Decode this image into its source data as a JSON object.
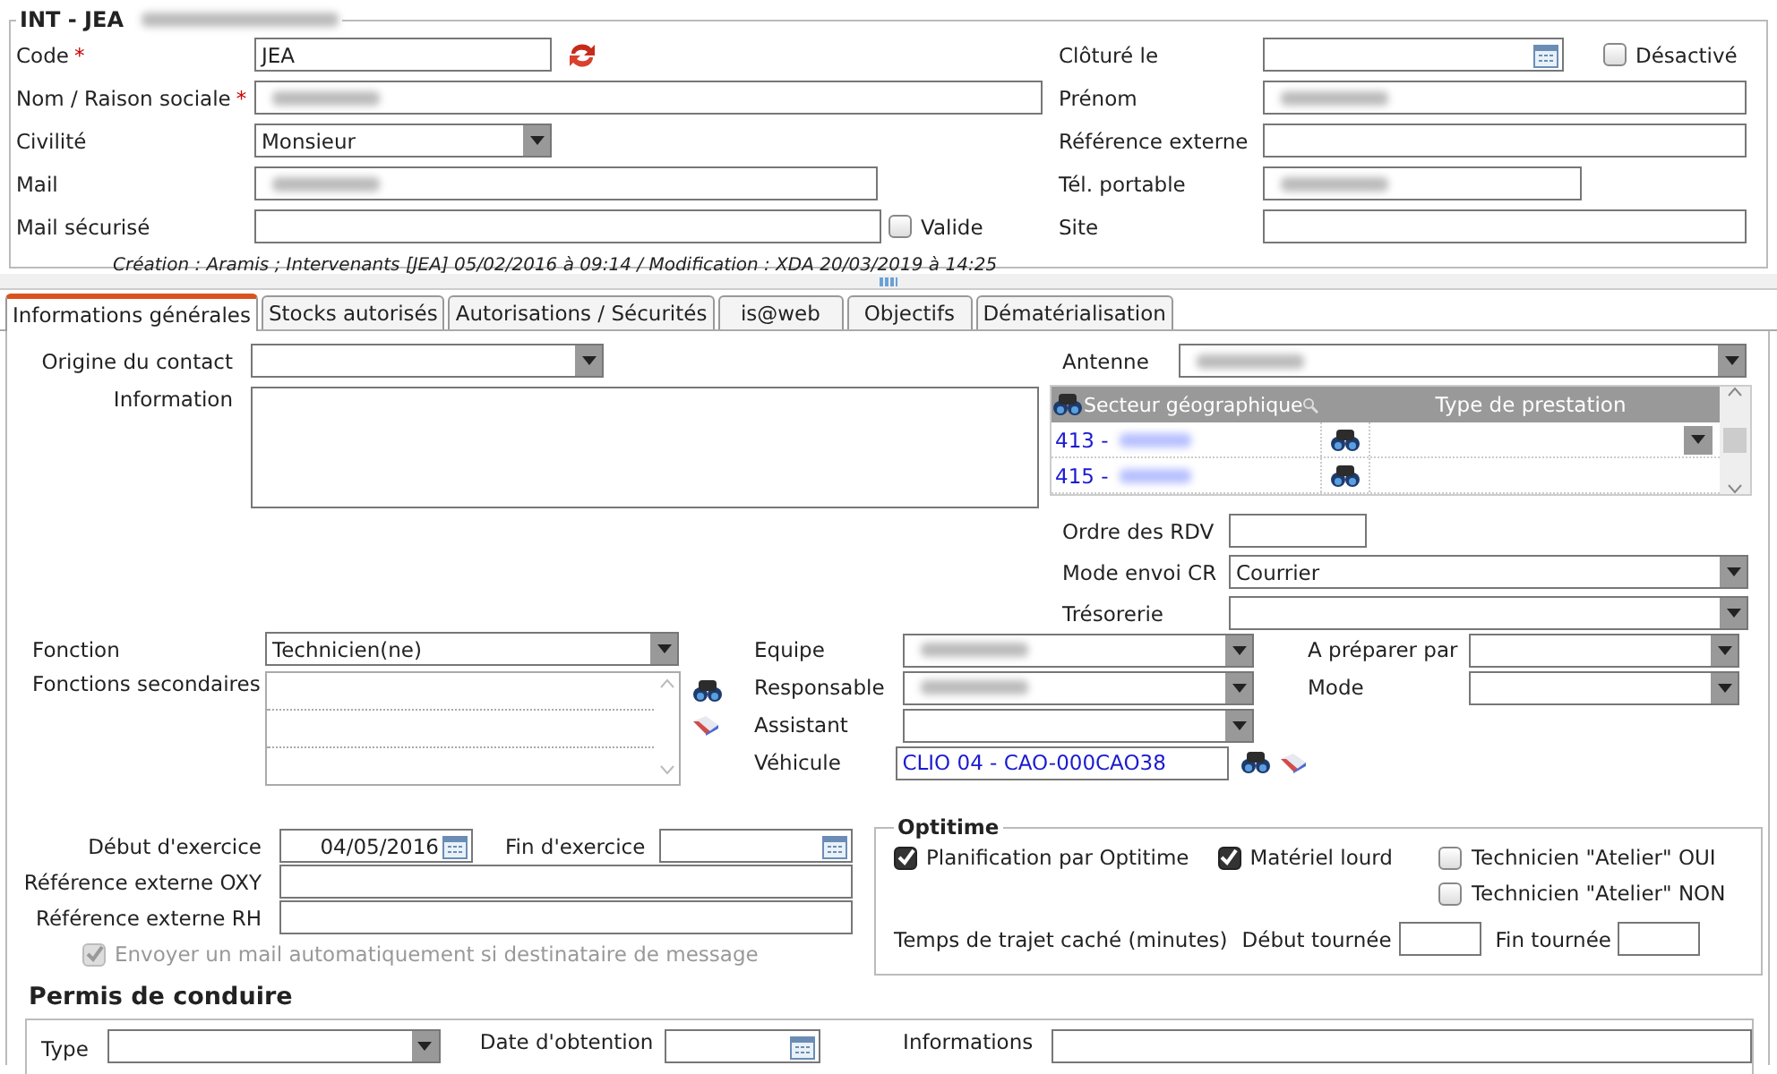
{
  "header": {
    "title": "INT - JEA",
    "title_blurred": true,
    "left": [
      {
        "kind": "text",
        "label": "Code",
        "required_mark": "*",
        "value": "JEA",
        "refresh": true
      },
      {
        "kind": "text",
        "label": "Nom / Raison sociale",
        "required_mark": "*",
        "blurred": true
      },
      {
        "kind": "select",
        "label": "Civilité",
        "value": "Monsieur"
      },
      {
        "kind": "text",
        "label": "Mail",
        "blurred": true
      },
      {
        "kind": "text",
        "label": "Mail sécurisé",
        "checkbox": {
          "label": "Valide",
          "checked": false
        }
      }
    ],
    "right": [
      {
        "kind": "date",
        "label": "Clôturé le",
        "checkbox": {
          "label": "Désactivé",
          "checked": false
        }
      },
      {
        "kind": "text",
        "label": "Prénom",
        "blurred": true
      },
      {
        "kind": "text",
        "label": "Référence externe"
      },
      {
        "kind": "text",
        "label": "Tél. portable",
        "blurred": true
      },
      {
        "kind": "text",
        "label": "Site"
      }
    ],
    "audit": "Création : Aramis ; Intervenants [JEA] 05/02/2016 à 09:14 / Modification : XDA 20/03/2019 à 14:25"
  },
  "tabs": [
    {
      "label": "Informations générales",
      "selected": true
    },
    {
      "label": "Stocks autorisés",
      "selected": false
    },
    {
      "label": "Autorisations / Sécurités",
      "selected": false
    },
    {
      "label": "is@web",
      "selected": false
    },
    {
      "label": "Objectifs",
      "selected": false
    },
    {
      "label": "Dématérialisation",
      "selected": false
    }
  ],
  "general": {
    "origin": {
      "label": "Origine du contact"
    },
    "information": {
      "label": "Information"
    },
    "antenne": {
      "label": "Antenne",
      "blurred": true
    },
    "sector_grid": {
      "columns": [
        "Secteur géographique",
        "Type de prestation"
      ],
      "rows": [
        {
          "code": "413 -",
          "type_dropdown": true
        },
        {
          "code": "415 -",
          "type_dropdown": false
        }
      ]
    },
    "right_fields": [
      {
        "kind": "text",
        "label": "Ordre des RDV"
      },
      {
        "kind": "select",
        "label": "Mode envoi CR",
        "value": "Courrier"
      },
      {
        "kind": "select",
        "label": "Trésorerie"
      }
    ],
    "col1": {
      "function": {
        "label": "Fonction",
        "value": "Technicien(ne)"
      },
      "secondary": {
        "label": "Fonctions secondaires"
      }
    },
    "col2": [
      {
        "kind": "select",
        "label": "Equipe",
        "blurred": true
      },
      {
        "kind": "select",
        "label": "Responsable",
        "blurred": true
      },
      {
        "kind": "select",
        "label": "Assistant"
      },
      {
        "kind": "lookup",
        "label": "Véhicule",
        "value": "CLIO 04 - CAO-000CAO38"
      }
    ],
    "col3": [
      {
        "label": "A préparer par"
      },
      {
        "label": "Mode"
      }
    ],
    "dates": [
      {
        "label": "Début d'exercice",
        "value": "04/05/2016"
      },
      {
        "label": "Fin d'exercice"
      }
    ],
    "refs": [
      {
        "label": "Référence externe OXY"
      },
      {
        "label": "Référence externe RH"
      }
    ],
    "auto_mail": {
      "label": "Envoyer un mail automatiquement si destinataire de message",
      "checked": true,
      "disabled": true
    },
    "optitime": {
      "title": "Optitime",
      "checks": [
        {
          "label": "Planification par Optitime",
          "checked": true
        },
        {
          "label": "Matériel lourd",
          "checked": true
        },
        {
          "label": "Technicien \"Atelier\" OUI",
          "checked": false
        },
        {
          "label": "Technicien \"Atelier\" NON",
          "checked": false
        }
      ],
      "trip_label": "Temps de trajet caché (minutes)",
      "fields": [
        {
          "label": "Début tournée"
        },
        {
          "label": "Fin tournée"
        }
      ]
    },
    "permis": {
      "title": "Permis de conduire",
      "fields": [
        {
          "kind": "select",
          "label": "Type"
        },
        {
          "kind": "date",
          "label": "Date d'obtention"
        },
        {
          "kind": "text",
          "label": "Informations"
        }
      ]
    }
  }
}
